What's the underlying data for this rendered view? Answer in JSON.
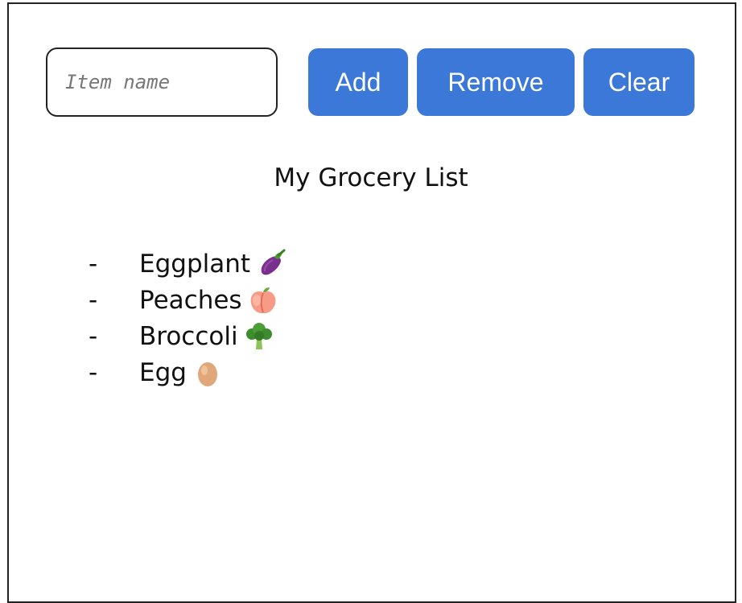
{
  "form": {
    "input_placeholder": "Item name",
    "input_value": "",
    "add_label": "Add",
    "remove_label": "Remove",
    "clear_label": "Clear"
  },
  "title": "My Grocery List",
  "list": {
    "bullet": "-",
    "items": [
      {
        "label": "Eggplant",
        "icon": "eggplant-icon"
      },
      {
        "label": "Peaches",
        "icon": "peach-icon"
      },
      {
        "label": "Broccoli",
        "icon": "broccoli-icon"
      },
      {
        "label": "Egg",
        "icon": "egg-icon"
      }
    ]
  },
  "colors": {
    "button_bg": "#3b78d8",
    "button_text": "#ffffff",
    "border": "#222222"
  }
}
